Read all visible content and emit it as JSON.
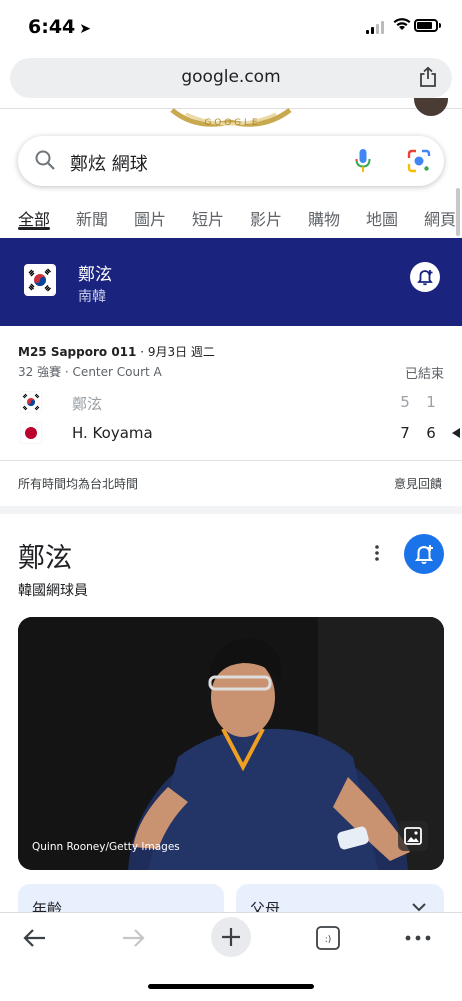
{
  "status_bar": {
    "time": "6:44",
    "location_arrow": "➤"
  },
  "browser": {
    "url": "google.com"
  },
  "search": {
    "query": "鄭炫 網球"
  },
  "tabs": [
    {
      "label": "全部",
      "active": true
    },
    {
      "label": "新聞"
    },
    {
      "label": "圖片"
    },
    {
      "label": "短片"
    },
    {
      "label": "影片"
    },
    {
      "label": "購物"
    },
    {
      "label": "地圖"
    },
    {
      "label": "網頁"
    }
  ],
  "banner": {
    "player": "鄭泫",
    "country": "南韓",
    "bg_color": "#1a237e"
  },
  "match": {
    "event": "M25 Sapporo 011",
    "date": "· 9月3日 週二",
    "round": "32 強賽",
    "court": "· Center Court A",
    "status": "已結束",
    "players": [
      {
        "name": "鄭泫",
        "flag": "korea-flag-icon",
        "set1": "5",
        "set2": "1",
        "winner": false
      },
      {
        "name": "H. Koyama",
        "flag": "japan-flag-icon",
        "set1": "7",
        "set2": "6",
        "winner": true
      }
    ],
    "footer_left": "所有時間均為台北時間",
    "footer_right": "意見回饋"
  },
  "knowledge_panel": {
    "title": "鄭泫",
    "subtitle": "韓國網球員",
    "photo_credit": "Quinn Rooney/Getty Images",
    "chips": [
      {
        "label": "年齡"
      },
      {
        "label": "父母"
      }
    ],
    "accent_color": "#1a73e8"
  }
}
